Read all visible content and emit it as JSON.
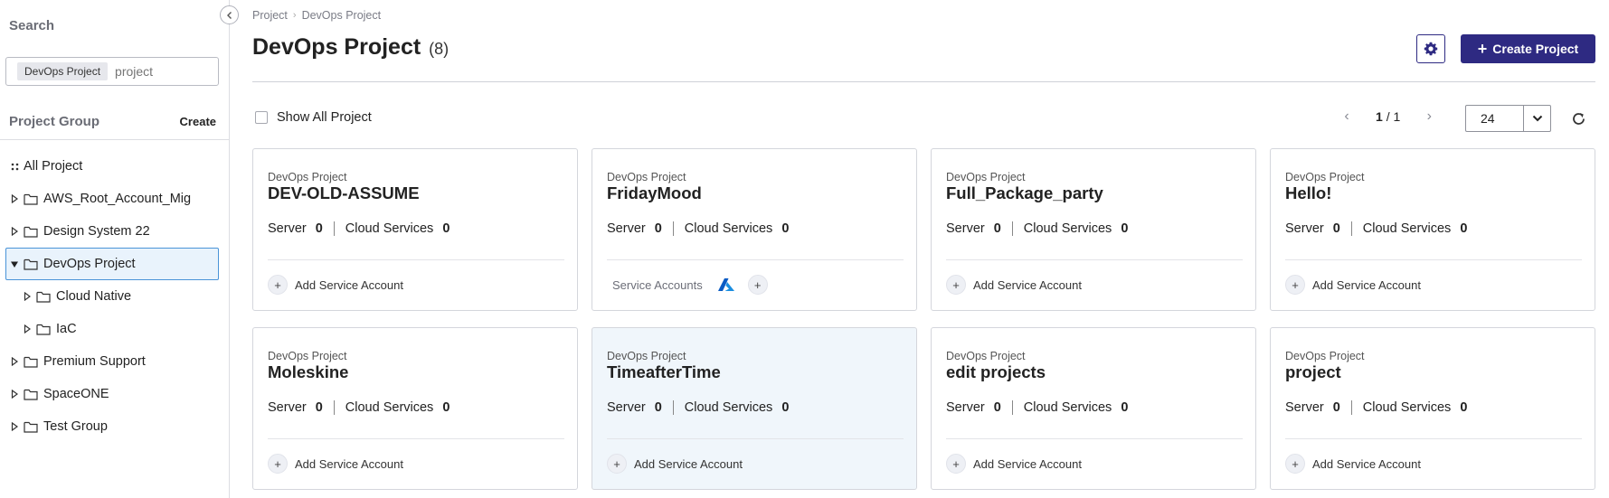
{
  "sidebar": {
    "search_title": "Search",
    "search_tag": "DevOps Project",
    "search_placeholder": "project",
    "project_group_title": "Project Group",
    "create_label": "Create",
    "tree": [
      {
        "label": "All Project",
        "type": "all",
        "level": 0
      },
      {
        "label": "AWS_Root_Account_Mig",
        "type": "folder",
        "level": 0,
        "expanded": false
      },
      {
        "label": "Design System 22",
        "type": "folder",
        "level": 0,
        "expanded": false
      },
      {
        "label": "DevOps Project",
        "type": "folder",
        "level": 0,
        "expanded": true,
        "selected": true
      },
      {
        "label": "Cloud Native",
        "type": "folder",
        "level": 1,
        "expanded": false
      },
      {
        "label": "IaC",
        "type": "folder",
        "level": 1,
        "expanded": false
      },
      {
        "label": "Premium Support",
        "type": "folder",
        "level": 0,
        "expanded": false
      },
      {
        "label": "SpaceONE",
        "type": "folder",
        "level": 0,
        "expanded": false
      },
      {
        "label": "Test Group",
        "type": "folder",
        "level": 0,
        "expanded": false
      }
    ]
  },
  "breadcrumb": [
    "Project",
    "DevOps Project"
  ],
  "header": {
    "title": "DevOps Project",
    "count": "(8)",
    "create_label": "Create Project"
  },
  "toolbar": {
    "show_all_label": "Show All Project",
    "page_current": "1",
    "page_sep": "/ 1",
    "page_size": "24"
  },
  "cards": [
    {
      "group": "DevOps Project",
      "name": "DEV-OLD-ASSUME",
      "server_label": "Server",
      "server": "0",
      "cloud_label": "Cloud Services",
      "cloud": "0",
      "footer": "Add Service Account",
      "has_accounts": false
    },
    {
      "group": "DevOps Project",
      "name": "FridayMood",
      "server_label": "Server",
      "server": "0",
      "cloud_label": "Cloud Services",
      "cloud": "0",
      "footer": "Service Accounts",
      "has_accounts": true
    },
    {
      "group": "DevOps Project",
      "name": "Full_Package_party",
      "server_label": "Server",
      "server": "0",
      "cloud_label": "Cloud Services",
      "cloud": "0",
      "footer": "Add Service Account",
      "has_accounts": false
    },
    {
      "group": "DevOps Project",
      "name": "Hello!",
      "server_label": "Server",
      "server": "0",
      "cloud_label": "Cloud Services",
      "cloud": "0",
      "footer": "Add Service Account",
      "has_accounts": false
    },
    {
      "group": "DevOps Project",
      "name": "Moleskine",
      "server_label": "Server",
      "server": "0",
      "cloud_label": "Cloud Services",
      "cloud": "0",
      "footer": "Add Service Account",
      "has_accounts": false
    },
    {
      "group": "DevOps Project",
      "name": "TimeafterTime",
      "server_label": "Server",
      "server": "0",
      "cloud_label": "Cloud Services",
      "cloud": "0",
      "footer": "Add Service Account",
      "has_accounts": false,
      "hover": true
    },
    {
      "group": "DevOps Project",
      "name": "edit projects",
      "server_label": "Server",
      "server": "0",
      "cloud_label": "Cloud Services",
      "cloud": "0",
      "footer": "Add Service Account",
      "has_accounts": false
    },
    {
      "group": "DevOps Project",
      "name": "project",
      "server_label": "Server",
      "server": "0",
      "cloud_label": "Cloud Services",
      "cloud": "0",
      "footer": "Add Service Account",
      "has_accounts": false
    }
  ],
  "colors": {
    "primary": "#2e2a82",
    "selected_bg": "#e9f3fc",
    "selected_border": "#4a94d8",
    "azure": "#0078d4"
  }
}
